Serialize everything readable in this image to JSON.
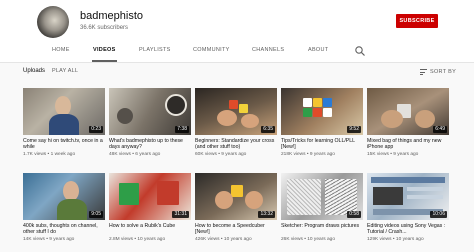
{
  "channel": {
    "name": "badmephisto",
    "subscribers": "36.6K subscribers",
    "subscribe_label": "SUBSCRIBE"
  },
  "tabs": [
    "HOME",
    "VIDEOS",
    "PLAYLISTS",
    "COMMUNITY",
    "CHANNELS",
    "ABOUT"
  ],
  "active_tab": "VIDEOS",
  "search_icon": "search-icon",
  "toolbar": {
    "uploads_label": "Uploads",
    "play_all_label": "PLAY ALL",
    "sort_label": "SORT BY",
    "sort_icon": "sort-icon"
  },
  "colors": {
    "subscribe": "#cc0000",
    "duration_bg": "#000000"
  },
  "videos": [
    {
      "title": "Come say hi on twitch.tv, once in a while",
      "views": "1.7K views",
      "age": "1 week ago",
      "duration": "0:23"
    },
    {
      "title": "What's badmephisto up to these days anyway?",
      "views": "48K views",
      "age": "6 years ago",
      "duration": "7:38"
    },
    {
      "title": "Beginners: Standardize your cross (and other stuff too)",
      "views": "60K views",
      "age": "9 years ago",
      "duration": "6:35"
    },
    {
      "title": "Tips/Tricks for learning OLL/PLL [New!]",
      "views": "218K views",
      "age": "9 years ago",
      "duration": "9:52"
    },
    {
      "title": "Mixed bag of things and my new iPhone app",
      "views": "15K views",
      "age": "9 years ago",
      "duration": "6:49"
    },
    {
      "title": "400k subs, thoughts on channel, other stuff I do",
      "views": "14K views",
      "age": "9 years ago",
      "duration": "9:05"
    },
    {
      "title": "How to solve a Rubik's Cube",
      "views": "2.8M views",
      "age": "10 years ago",
      "duration": "31:31"
    },
    {
      "title": "How to become a Speedcuber [New!]",
      "views": "426K views",
      "age": "10 years ago",
      "duration": "13:32"
    },
    {
      "title": "Sketcher: Program draws pictures",
      "views": "26K views",
      "age": "10 years ago",
      "duration": "0:58"
    },
    {
      "title": "Editing videos using Sony Vegas : Tutorial / Crash...",
      "views": "129K views",
      "age": "10 years ago",
      "duration": "10:06"
    }
  ],
  "meta_separator": "•"
}
